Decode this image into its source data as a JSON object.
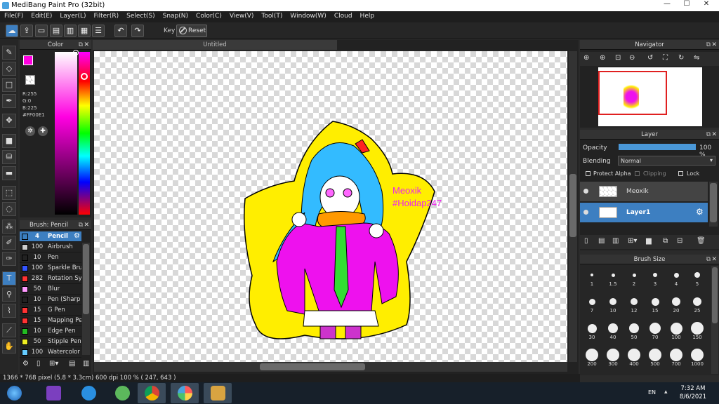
{
  "window": {
    "title": "MediBang Paint Pro (32bit)",
    "minimize": "—",
    "maximize": "☐",
    "close": "✕"
  },
  "menu": [
    "File(F)",
    "Edit(E)",
    "Layer(L)",
    "Filter(R)",
    "Select(S)",
    "Snap(N)",
    "Color(C)",
    "View(V)",
    "Tool(T)",
    "Window(W)",
    "Cloud",
    "Help"
  ],
  "toolbar": {
    "key_label": "Key",
    "reset_label": "Reset"
  },
  "document": {
    "tab_title": "Untitled"
  },
  "color_panel": {
    "title": "Color",
    "fg_color": "#FF00E1",
    "r": "R:255",
    "g": "G:0",
    "b": "B:225",
    "hex": "#FF00E1"
  },
  "brush_panel": {
    "title": "Brush: Pencil",
    "items": [
      {
        "size": "4",
        "name": "Pencil",
        "color": "#3a7fc0"
      },
      {
        "size": "100",
        "name": "Airbrush",
        "color": "#cccccc"
      },
      {
        "size": "10",
        "name": "Pen",
        "color": "#222222"
      },
      {
        "size": "100",
        "name": "Sparkle Bru",
        "color": "#3355ff"
      },
      {
        "size": "282",
        "name": "Rotation Sy",
        "color": "#ff3333"
      },
      {
        "size": "50",
        "name": "Blur",
        "color": "#ff99ff"
      },
      {
        "size": "10",
        "name": "Pen (Sharp",
        "color": "#222222"
      },
      {
        "size": "15",
        "name": "G Pen",
        "color": "#ff3333"
      },
      {
        "size": "15",
        "name": "Mapping Pe",
        "color": "#ff3333"
      },
      {
        "size": "10",
        "name": "Edge Pen",
        "color": "#22bb22"
      },
      {
        "size": "50",
        "name": "Stipple Pen",
        "color": "#eeee22"
      },
      {
        "size": "100",
        "name": "Watercolor",
        "color": "#66ccff"
      }
    ]
  },
  "navigator": {
    "title": "Navigator"
  },
  "layer_panel": {
    "title": "Layer",
    "opacity_label": "Opacity",
    "opacity_value": "100 %",
    "opacity_fraction": 1.0,
    "blending_label": "Blending",
    "blending_value": "Normal",
    "protect_alpha": "Protect Alpha",
    "clipping": "Clipping",
    "lock": "Lock",
    "layers": [
      {
        "name": "Meoxik",
        "selected": false
      },
      {
        "name": "Layer1",
        "selected": true
      }
    ]
  },
  "brush_size": {
    "title": "Brush Size",
    "sizes": [
      "1",
      "1.5",
      "2",
      "3",
      "4",
      "5",
      "7",
      "10",
      "12",
      "15",
      "20",
      "25",
      "30",
      "40",
      "50",
      "70",
      "100",
      "150",
      "200",
      "300",
      "400",
      "500",
      "700",
      "1000"
    ]
  },
  "artwork": {
    "signature_line1": "Meoxik",
    "signature_line2": "#Hoidap247"
  },
  "status": {
    "text": "1366 * 768 pixel  (5.8 * 3.3cm)  600 dpi  100 %  ( 247, 643 )"
  },
  "taskbar": {
    "lang": "EN",
    "time": "7:32 AM",
    "date": "8/6/2021"
  }
}
